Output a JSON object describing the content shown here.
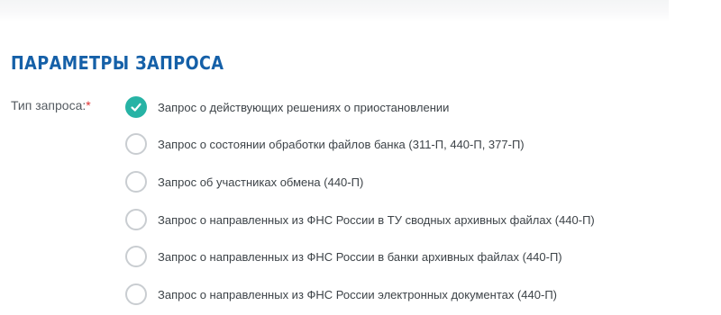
{
  "section": {
    "title": "ПАРАМЕТРЫ ЗАПРОСА"
  },
  "field": {
    "label": "Тип запроса:",
    "required_mark": "*"
  },
  "options": [
    {
      "label": "Запрос о действующих решениях о приостановлении",
      "selected": true
    },
    {
      "label": "Запрос о состоянии обработки файлов банка (311-П, 440-П, 377-П)",
      "selected": false
    },
    {
      "label": "Запрос об участниках обмена (440-П)",
      "selected": false
    },
    {
      "label": "Запрос о направленных из ФНС России в ТУ сводных архивных файлах (440-П)",
      "selected": false
    },
    {
      "label": "Запрос о направленных из ФНС России в банки архивных файлах (440-П)",
      "selected": false
    },
    {
      "label": "Запрос о направленных из ФНС России электронных документах (440-П)",
      "selected": false
    }
  ],
  "colors": {
    "title": "#1560a8",
    "radio_selected": "#27b3a5",
    "radio_border": "#c9cdd1",
    "required": "#e03131"
  }
}
